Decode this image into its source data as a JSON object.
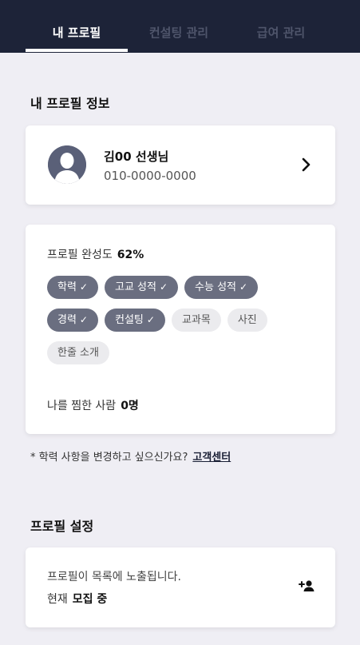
{
  "tabs": [
    {
      "label": "내 프로필",
      "active": true
    },
    {
      "label": "컨설팅 관리",
      "active": false
    },
    {
      "label": "급여 관리",
      "active": false
    }
  ],
  "profile_section": {
    "title": "내 프로필 정보"
  },
  "profile_card": {
    "name": "김00 선생님",
    "phone": "010-0000-0000"
  },
  "completion": {
    "label": "프로필 완성도",
    "value": "62%",
    "chips": [
      {
        "label": "학력",
        "done": true
      },
      {
        "label": "고교 성적",
        "done": true
      },
      {
        "label": "수능 성적",
        "done": true
      },
      {
        "label": "경력",
        "done": true
      },
      {
        "label": "컨설팅",
        "done": true
      },
      {
        "label": "교과목",
        "done": false
      },
      {
        "label": "사진",
        "done": false
      },
      {
        "label": "한줄 소개",
        "done": false
      }
    ],
    "likes_label": "나를 찜한 사람",
    "likes_value": "0명"
  },
  "note": {
    "text": "* 학력 사항을 변경하고 싶으신가요?",
    "link": "고객센터"
  },
  "settings_section": {
    "title": "프로필 설정"
  },
  "settings_card": {
    "description": "프로필이 목록에 노출됩니다.",
    "status_label": "현재",
    "status_value": "모집 중"
  },
  "colors": {
    "header_bg": "#1d2338",
    "chip_done": "#6a6e80",
    "chip_todo": "#ebebee",
    "page_bg": "#efeef4"
  },
  "icons": {
    "check": "✓",
    "chevron": "chevron-right-icon",
    "add_user": "add-user-icon",
    "avatar": "person-silhouette"
  }
}
